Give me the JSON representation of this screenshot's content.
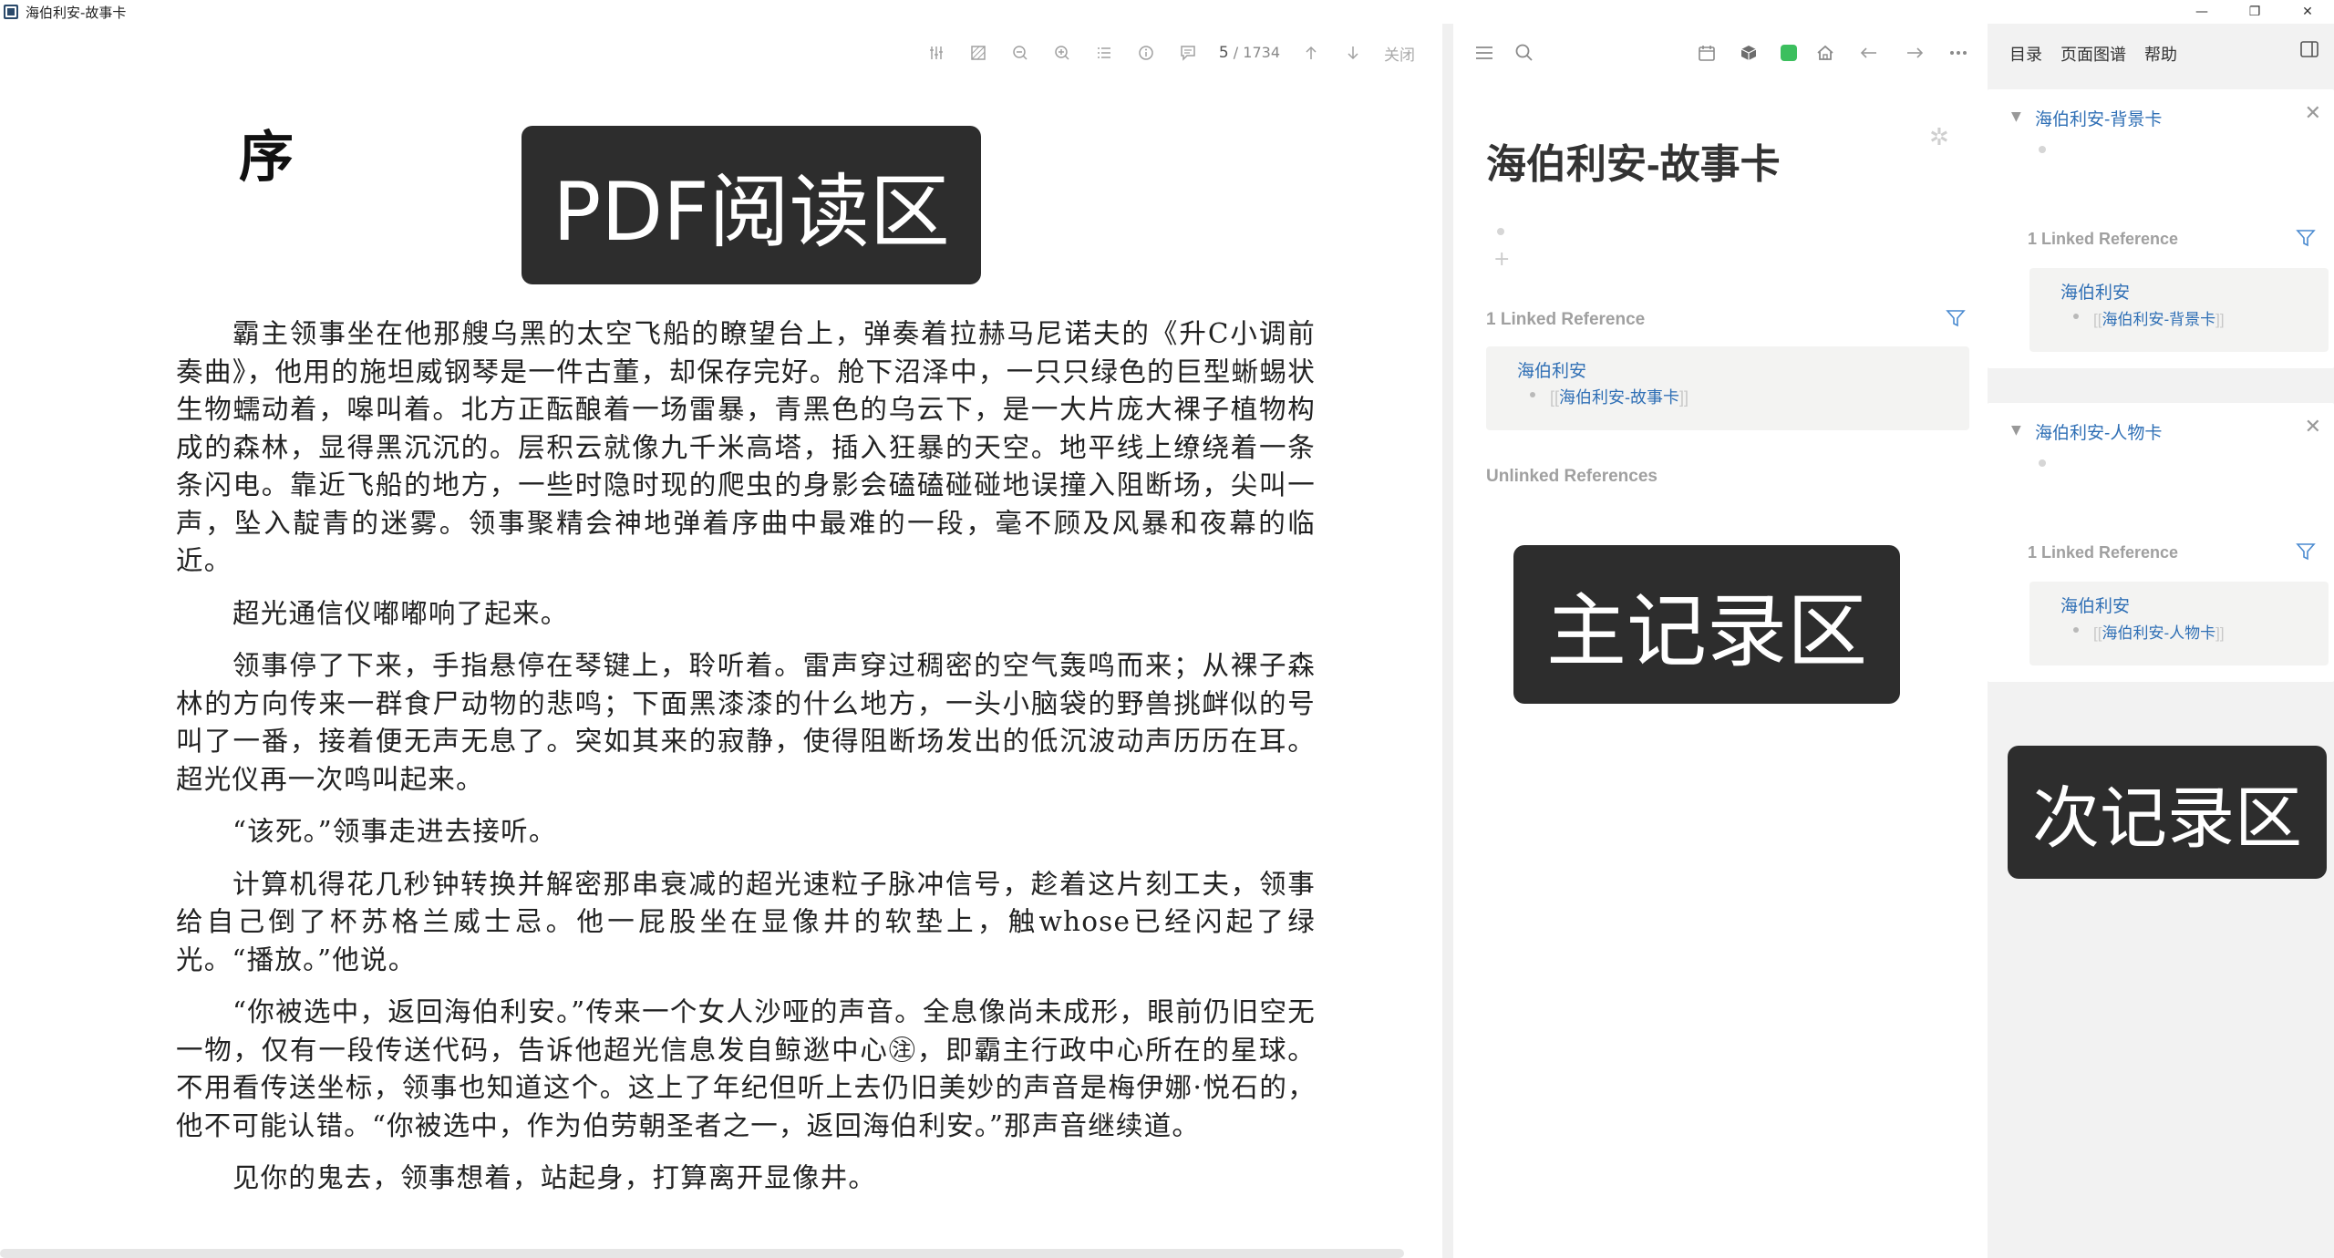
{
  "window": {
    "title": "海伯利安-故事卡",
    "controls": {
      "minimize": "—",
      "maximize": "❐",
      "close": "✕"
    }
  },
  "pdf": {
    "page_current": "5",
    "page_sep": " / ",
    "page_total": "1734",
    "close_label": "关闭",
    "heading": "序",
    "paragraphs": [
      "霸主领事坐在他那艘乌黑的太空飞船的瞭望台上，弹奏着拉赫马尼诺夫的《升C小调前奏曲》，他用的施坦威钢琴是一件古董，却保存完好。舱下沼泽中，一只只绿色的巨型蜥蜴状生物蠕动着，嗥叫着。北方正酝酿着一场雷暴，青黑色的乌云下，是一大片庞大裸子植物构成的森林，显得黑沉沉的。层积云就像九千米高塔，插入狂暴的天空。地平线上缭绕着一条条闪电。靠近飞船的地方，一些时隐时现的爬虫的身影会磕磕碰碰地误撞入阻断场，尖叫一声，坠入靛青的迷雾。领事聚精会神地弹着序曲中最难的一段，毫不顾及风暴和夜幕的临近。",
      "超光通信仪嘟嘟响了起来。",
      "领事停了下来，手指悬停在琴键上，聆听着。雷声穿过稠密的空气轰鸣而来；从裸子森林的方向传来一群食尸动物的悲鸣；下面黑漆漆的什么地方，一头小脑袋的野兽挑衅似的号叫了一番，接着便无声无息了。突如其来的寂静，使得阻断场发出的低沉波动声历历在耳。超光仪再一次鸣叫起来。",
      "“该死。”领事走进去接听。",
      "计算机得花几秒钟转换并解密那串衰减的超光速粒子脉冲信号，趁着这片刻工夫，领事给自己倒了杯苏格兰威士忌。他一屁股坐在显像井的软垫上，触whose已经闪起了绿光。“播放。”他说。",
      "“你被选中，返回海伯利安。”传来一个女人沙哑的声音。全息像尚未成形，眼前仍旧空无一物，仅有一段传送代码，告诉他超光信息发自鲸逖中心㊟，即霸主行政中心所在的星球。不用看传送坐标，领事也知道这个。这上了年纪但听上去仍旧美妙的声音是梅伊娜·悦石的，他不可能认错。“你被选中，作为伯劳朝圣者之一，返回海伯利安。”那声音继续道。",
      "见你的鬼去，领事想着，站起身，打算离开显像井。"
    ]
  },
  "overlays": {
    "pdf_area": "PDF阅读区",
    "main_area": "主记录区",
    "side_area": "次记录区"
  },
  "main": {
    "title": "海伯利安-故事卡",
    "linked_heading": "1 Linked Reference",
    "unlinked_heading": "Unlinked References",
    "ref_title": "海伯利安",
    "ref_link": "海伯利安-故事卡",
    "bracket_open": "[[",
    "bracket_close": "]]"
  },
  "sidebar": {
    "tabs": [
      "目录",
      "页面图谱",
      "帮助"
    ],
    "cards": [
      {
        "title": "海伯利安-背景卡",
        "linked_heading": "1 Linked Reference",
        "ref_title": "海伯利安",
        "ref_link": "海伯利安-背景卡"
      },
      {
        "title": "海伯利安-人物卡",
        "linked_heading": "1 Linked Reference",
        "ref_title": "海伯利安",
        "ref_link": "海伯利安-人物卡"
      }
    ]
  },
  "colors": {
    "accent": "#2f6fb5",
    "overlay_bg": "#2d2d2d",
    "sidebar_bg": "#f2f2f2",
    "status_green": "#3cbf5e"
  },
  "icons": {
    "pdf_toolbar": [
      "settings-sliders-icon",
      "highlight-area-icon",
      "zoom-out-icon",
      "zoom-in-icon",
      "outline-list-icon",
      "info-icon",
      "comment-icon",
      "arrow-up-icon",
      "arrow-down-icon"
    ],
    "main_toolbar": [
      "menu-icon",
      "search-icon",
      "calendar-icon",
      "cube-icon",
      "sync-status-icon",
      "home-icon",
      "back-arrow-icon",
      "forward-arrow-icon",
      "more-icon"
    ]
  }
}
